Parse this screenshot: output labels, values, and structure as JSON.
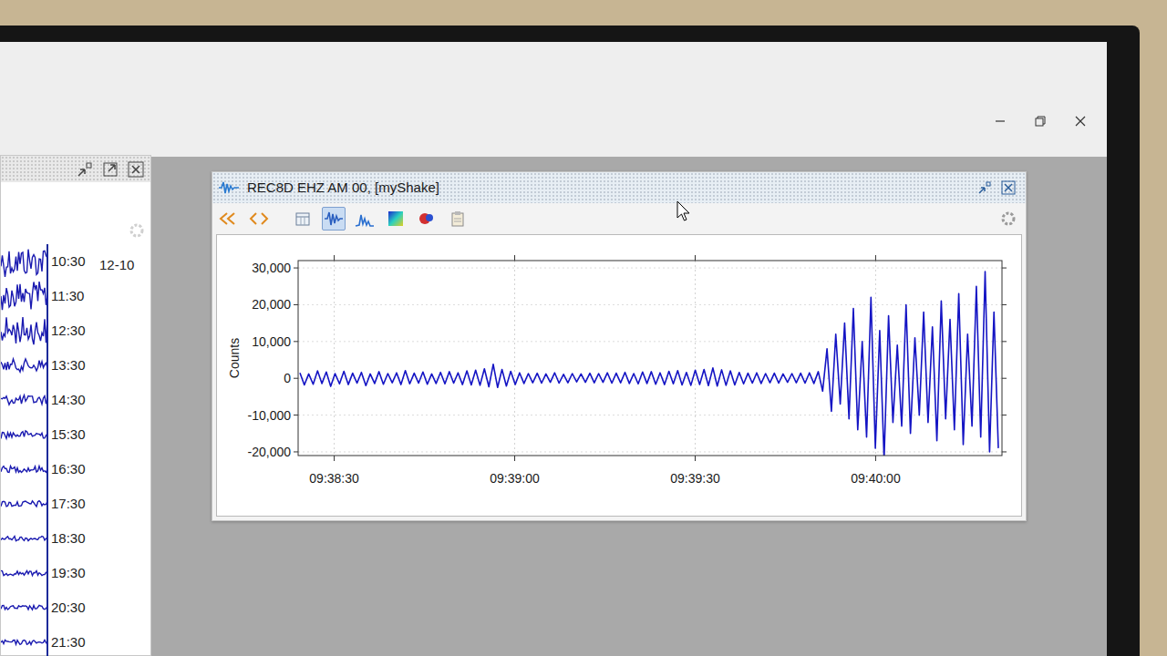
{
  "helicorder": {
    "date": "12-10",
    "rows": [
      {
        "time": "10:30",
        "level": 0.95
      },
      {
        "time": "11:30",
        "level": 0.9
      },
      {
        "time": "12:30",
        "level": 0.85
      },
      {
        "time": "13:30",
        "level": 0.4
      },
      {
        "time": "14:30",
        "level": 0.3
      },
      {
        "time": "15:30",
        "level": 0.25
      },
      {
        "time": "16:30",
        "level": 0.2
      },
      {
        "time": "17:30",
        "level": 0.2
      },
      {
        "time": "18:30",
        "level": 0.15
      },
      {
        "time": "19:30",
        "level": 0.15
      },
      {
        "time": "20:30",
        "level": 0.15
      },
      {
        "time": "21:30",
        "level": 0.15
      }
    ]
  },
  "wave_window": {
    "title": "REC8D EHZ AM 00, [myShake]",
    "toolbar": [
      {
        "selected": false
      },
      {
        "selected": false
      },
      {
        "selected": false
      },
      {
        "selected": true
      },
      {
        "selected": false
      },
      {
        "selected": false
      },
      {
        "selected": false
      },
      {
        "selected": false
      }
    ],
    "chart": {
      "y_label": "Counts",
      "y_ticks": [
        "30,000",
        "20,000",
        "10,000",
        "0",
        "-10,000",
        "-20,000"
      ],
      "x_ticks": [
        "09:38:30",
        "09:39:00",
        "09:39:30",
        "09:40:00"
      ],
      "series": [
        {
          "values": [
            1500,
            -1800,
            1200,
            -1600,
            2000,
            -1400,
            1700,
            -2200,
            1300,
            -1500,
            1900,
            -1700,
            1400,
            -1300,
            1600,
            -2000,
            1200,
            -1400,
            1800,
            -1600,
            1300,
            -1200,
            1500,
            -1700,
            2100,
            -1500,
            1400,
            -1300,
            1700,
            -1600,
            1200,
            -1400,
            1600,
            -1500,
            1800,
            -1300,
            1500,
            -1700,
            2000,
            -1800,
            2200,
            -1900,
            2600,
            -2300,
            3800,
            -2500,
            2400,
            -2100,
            1900,
            -1700,
            1500,
            -1400,
            1300,
            -1200,
            1400,
            -1300,
            1200,
            -1100,
            1500,
            -1300,
            1100,
            -1200,
            1300,
            -1000,
            1200,
            -1100,
            1400,
            -1200,
            1300,
            -1100,
            1500,
            -1300,
            1400,
            -1200,
            1600,
            -1400,
            1300,
            -1500,
            1700,
            -1400,
            1800,
            -1600,
            1500,
            -1700,
            1900,
            -1500,
            2100,
            -1800,
            1600,
            -1900,
            2200,
            -1700,
            2400,
            -2000,
            2800,
            -2100,
            2300,
            -1900,
            2000,
            -1800,
            1600,
            -1500,
            1400,
            -1300,
            1500,
            -1400,
            1300,
            -1200,
            1400,
            -1300,
            1200,
            -1100,
            1300,
            -1200,
            1400,
            -1300,
            1500,
            -1400,
            1800,
            -3500,
            8000,
            -9000,
            12000,
            -7000,
            15000,
            -11000,
            19000,
            -14000,
            10000,
            -16000,
            22000,
            -19000,
            13000,
            -22000,
            17000,
            -12000,
            9000,
            -13000,
            20000,
            -15000,
            11000,
            -10000,
            18000,
            -12000,
            14000,
            -17000,
            21000,
            -11000,
            16000,
            -14000,
            23000,
            -18000,
            12000,
            -13000,
            25000,
            -16000,
            29000,
            -20000,
            18000,
            -19000
          ]
        }
      ]
    }
  }
}
